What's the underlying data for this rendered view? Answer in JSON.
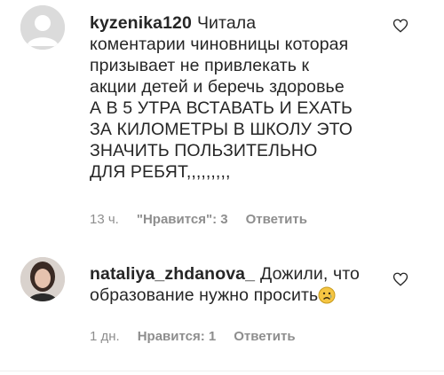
{
  "comments": [
    {
      "username": "kyzenika120",
      "text": "Читала коментарии чиновницы которая призывает не привлекать к акции детей и беречь здоровье А В 5 УТРА ВСТАВАТЬ И ЕХАТЬ ЗА КИЛОМЕТРЫ В ШКОЛУ ЭТО ЗНАЧИТЬ ПОЛЬЗИТЕЛЬНО ДЛЯ РЕБЯТ,,,,,,,,,",
      "time": "13 ч.",
      "likes": "\"Нравится\": 3",
      "reply": "Ответить",
      "avatar": "default-avatar-icon"
    },
    {
      "username": "nataliya_zhdanova_",
      "text": "Дожили, что образование нужно просить",
      "emoji": "😥",
      "time": "1 дн.",
      "likes": "Нравится: 1",
      "reply": "Ответить",
      "avatar": "user-photo"
    }
  ],
  "colors": {
    "text": "#262626",
    "meta": "#8e8e8e",
    "avatar_bg": "#dbdbdb"
  }
}
